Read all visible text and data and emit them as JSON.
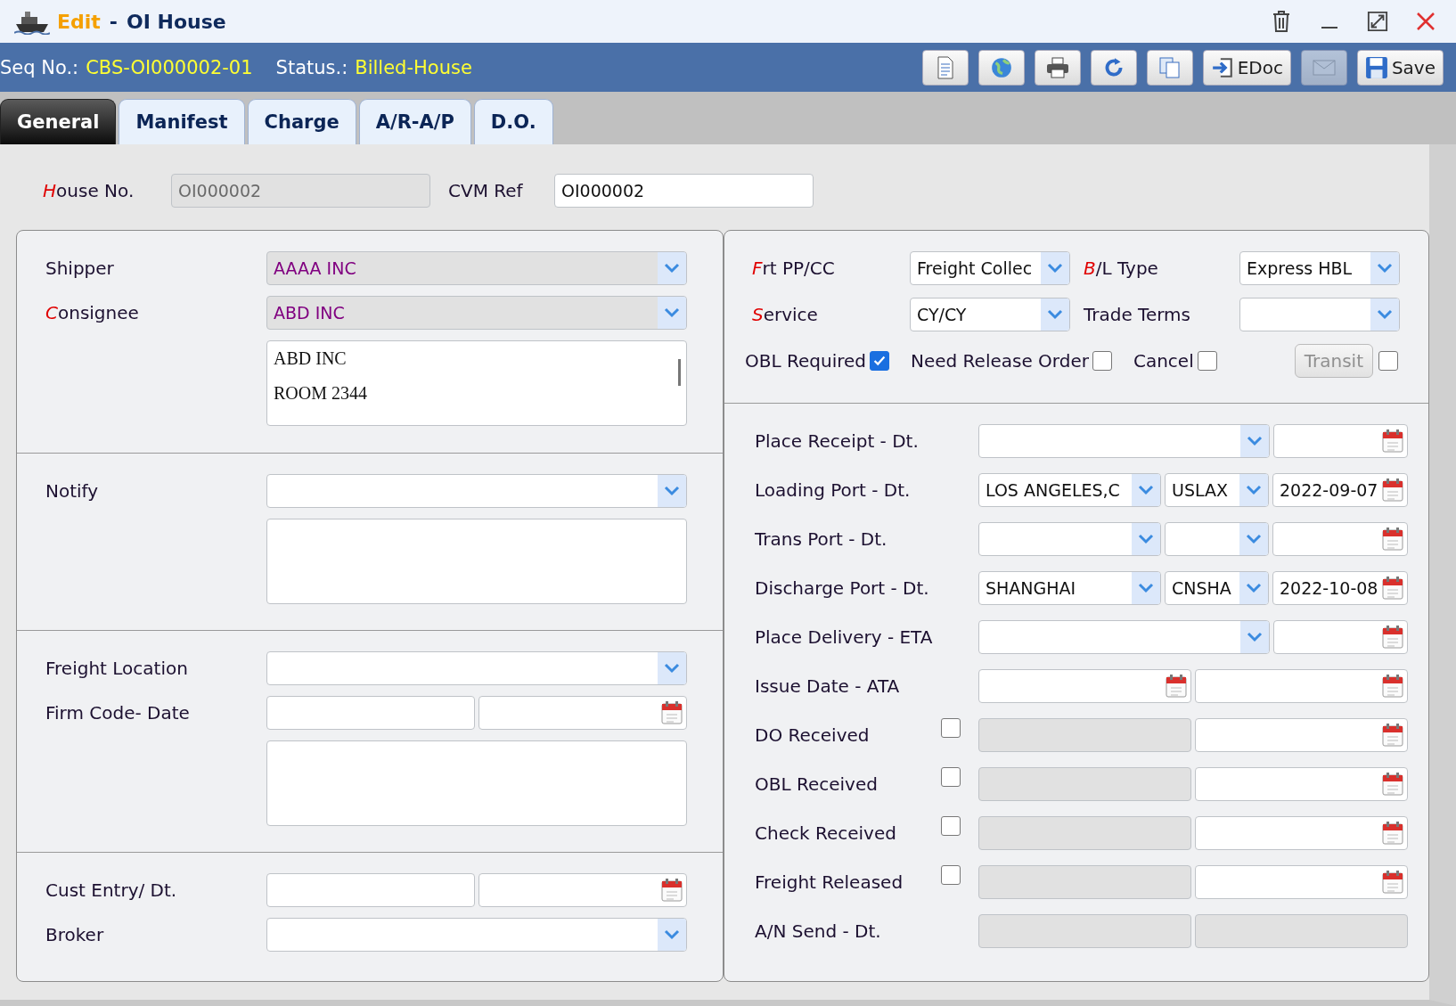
{
  "window": {
    "mode": "Edit",
    "separator": "-",
    "title": "OI House"
  },
  "header": {
    "seq_label": "Seq No.:",
    "seq_value": "CBS-OI000002-01",
    "status_label": "Status.:",
    "status_value": "Billed-House"
  },
  "toolbar": [
    {
      "kind": "document",
      "disabled": false
    },
    {
      "kind": "globe",
      "disabled": false
    },
    {
      "kind": "print",
      "disabled": false
    },
    {
      "kind": "refresh",
      "disabled": false
    },
    {
      "kind": "copy",
      "disabled": false
    },
    {
      "kind": "import",
      "label": "EDoc",
      "disabled": false
    },
    {
      "kind": "mail",
      "disabled": true
    },
    {
      "kind": "save",
      "label": "Save",
      "disabled": false
    }
  ],
  "tabs": [
    {
      "label": "General",
      "selected": true
    },
    {
      "label": "Manifest",
      "selected": false
    },
    {
      "label": "Charge",
      "selected": false
    },
    {
      "label": "A/R-A/P",
      "selected": false
    },
    {
      "label": "D.O.",
      "selected": false
    }
  ],
  "house": {
    "house_no": {
      "label": "House No.",
      "required": true,
      "value": "OI000002",
      "disabled": true
    },
    "cvm_ref": {
      "label": "CVM Ref",
      "required": false,
      "value": "OI000002",
      "disabled": false
    }
  },
  "left_sections": [
    {
      "rows": [
        {
          "label": "Shipper",
          "required": false,
          "fields": [
            {
              "kind": "select",
              "value": "AAAA INC",
              "locked": true
            }
          ]
        },
        {
          "label": "Consignee",
          "required": true,
          "fields": [
            {
              "kind": "select",
              "value": "ABD INC",
              "locked": true
            }
          ]
        },
        {
          "fields": [
            {
              "kind": "textarea",
              "lines": [
                "ABD INC",
                "ROOM 2344"
              ]
            }
          ]
        }
      ]
    },
    {
      "rows": [
        {
          "label": "Notify",
          "required": false,
          "fields": [
            {
              "kind": "select",
              "locked": false
            }
          ]
        },
        {
          "fields": [
            {
              "kind": "textarea"
            }
          ]
        }
      ]
    },
    {
      "rows": [
        {
          "label": "Freight Location",
          "required": false,
          "fields": [
            {
              "kind": "select",
              "locked": false
            }
          ]
        },
        {
          "label": "Firm Code- Date",
          "required": false,
          "fields": [
            {
              "kind": "input"
            },
            {
              "kind": "date"
            }
          ]
        },
        {
          "fields": [
            {
              "kind": "textarea"
            }
          ]
        }
      ]
    },
    {
      "rows": [
        {
          "label": "Cust Entry/ Dt.",
          "required": false,
          "fields": [
            {
              "kind": "input"
            },
            {
              "kind": "date"
            }
          ]
        },
        {
          "label": "Broker",
          "required": false,
          "fields": [
            {
              "kind": "select",
              "locked": false
            }
          ]
        }
      ]
    }
  ],
  "terms": {
    "fields": [
      {
        "label": "Frt PP/CC",
        "required": true,
        "value": "Freight Collec"
      },
      {
        "label": "B/L Type",
        "required": true,
        "value": "Express HBL"
      },
      {
        "label": "Service",
        "required": true,
        "value": "CY/CY"
      },
      {
        "label": "Trade Terms",
        "required": false
      }
    ],
    "flags": [
      {
        "kind": "checkbox",
        "label": "OBL Required",
        "checked": true,
        "disabled": false
      },
      {
        "kind": "checkbox",
        "label": "Need Release Order",
        "checked": false,
        "disabled": false
      },
      {
        "kind": "checkbox",
        "label": "Cancel",
        "checked": false,
        "disabled": false
      },
      {
        "kind": "button",
        "label": "Transit",
        "checked": false,
        "disabled": true
      }
    ]
  },
  "routing": [
    {
      "label": "Place Receipt - Dt.",
      "fields": [
        {
          "kind": "select"
        },
        {
          "kind": "date"
        }
      ]
    },
    {
      "label": "Loading Port - Dt.",
      "fields": [
        {
          "kind": "select",
          "value": "LOS ANGELES,C"
        },
        {
          "kind": "select",
          "value": "USLAX"
        },
        {
          "kind": "date",
          "value": "2022-09-07"
        }
      ]
    },
    {
      "label": "Trans Port - Dt.",
      "fields": [
        {
          "kind": "select"
        },
        {
          "kind": "select"
        },
        {
          "kind": "date"
        }
      ]
    },
    {
      "label": "Discharge Port - Dt.",
      "fields": [
        {
          "kind": "select",
          "value": "SHANGHAI"
        },
        {
          "kind": "select",
          "value": "CNSHA"
        },
        {
          "kind": "date",
          "value": "2022-10-08"
        }
      ]
    },
    {
      "label": "Place Delivery - ETA",
      "fields": [
        {
          "kind": "select"
        },
        {
          "kind": "date"
        }
      ]
    },
    {
      "label": "Issue Date - ATA",
      "fields": [
        {
          "kind": "date"
        },
        {
          "kind": "date"
        }
      ]
    },
    {
      "label": "DO Received",
      "checked": false,
      "fields": [
        {
          "kind": "disabled"
        },
        {
          "kind": "date"
        }
      ]
    },
    {
      "label": "OBL Received",
      "checked": false,
      "fields": [
        {
          "kind": "disabled"
        },
        {
          "kind": "date"
        }
      ]
    },
    {
      "label": "Check Received",
      "checked": false,
      "fields": [
        {
          "kind": "disabled"
        },
        {
          "kind": "date"
        }
      ]
    },
    {
      "label": "Freight Released",
      "checked": false,
      "fields": [
        {
          "kind": "disabled"
        },
        {
          "kind": "date"
        }
      ]
    },
    {
      "label": "A/N Send - Dt.",
      "fields": [
        {
          "kind": "disabled"
        },
        {
          "kind": "disabled"
        }
      ]
    }
  ]
}
